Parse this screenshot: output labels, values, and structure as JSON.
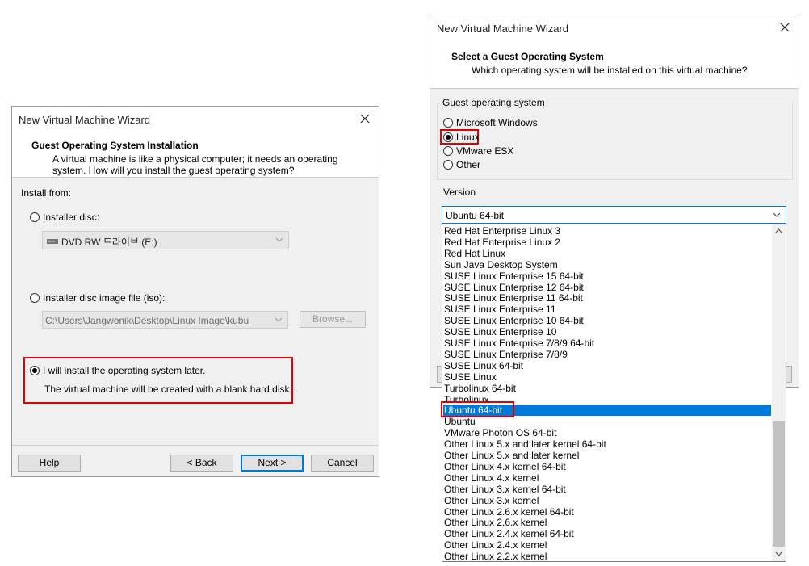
{
  "left_dialog": {
    "title": "New Virtual Machine Wizard",
    "header_title": "Guest Operating System Installation",
    "header_subtitle_line1": "A virtual machine is like a physical computer; it needs an operating",
    "header_subtitle_line2": "system. How will you install the guest operating system?",
    "install_from_label": "Install from:",
    "installer_disc_label": "Installer disc:",
    "installer_disc_value": "DVD RW 드라이브 (E:)",
    "iso_label": "Installer disc image file (iso):",
    "iso_value": "C:\\Users\\Jangwonik\\Desktop\\Linux Image\\kubu",
    "browse_label": "Browse...",
    "later_label": "I will install the operating system later.",
    "later_desc": "The virtual machine will be created with a blank hard disk.",
    "selected_option": "later",
    "help_label": "Help",
    "back_label": "< Back",
    "next_label": "Next >",
    "cancel_label": "Cancel"
  },
  "right_dialog": {
    "title": "New Virtual Machine Wizard",
    "header_title": "Select a Guest Operating System",
    "header_subtitle": "Which operating system will be installed on this virtual machine?",
    "guest_os_group_label": "Guest operating system",
    "os_options": [
      "Microsoft Windows",
      "Linux",
      "VMware ESX",
      "Other"
    ],
    "selected_os": "Linux",
    "version_group_label": "Version",
    "version_selected": "Ubuntu 64-bit",
    "version_list": [
      "Red Hat Enterprise Linux 3",
      "Red Hat Enterprise Linux 2",
      "Red Hat Linux",
      "Sun Java Desktop System",
      "SUSE Linux Enterprise 15 64-bit",
      "SUSE Linux Enterprise 12 64-bit",
      "SUSE Linux Enterprise 11 64-bit",
      "SUSE Linux Enterprise 11",
      "SUSE Linux Enterprise 10 64-bit",
      "SUSE Linux Enterprise 10",
      "SUSE Linux Enterprise 7/8/9 64-bit",
      "SUSE Linux Enterprise 7/8/9",
      "SUSE Linux 64-bit",
      "SUSE Linux",
      "Turbolinux 64-bit",
      "Turbolinux",
      "Ubuntu 64-bit",
      "Ubuntu",
      "VMware Photon OS 64-bit",
      "Other Linux 5.x and later kernel 64-bit",
      "Other Linux 5.x and later kernel",
      "Other Linux 4.x kernel 64-bit",
      "Other Linux 4.x kernel",
      "Other Linux 3.x kernel 64-bit",
      "Other Linux 3.x kernel",
      "Other Linux 2.6.x kernel 64-bit",
      "Other Linux 2.6.x kernel",
      "Other Linux 2.4.x kernel 64-bit",
      "Other Linux 2.4.x kernel",
      "Other Linux 2.2.x kernel"
    ],
    "highlighted_item": "Ubuntu 64-bit"
  },
  "colors": {
    "highlight": "#e30000",
    "selection": "#0078d7"
  }
}
